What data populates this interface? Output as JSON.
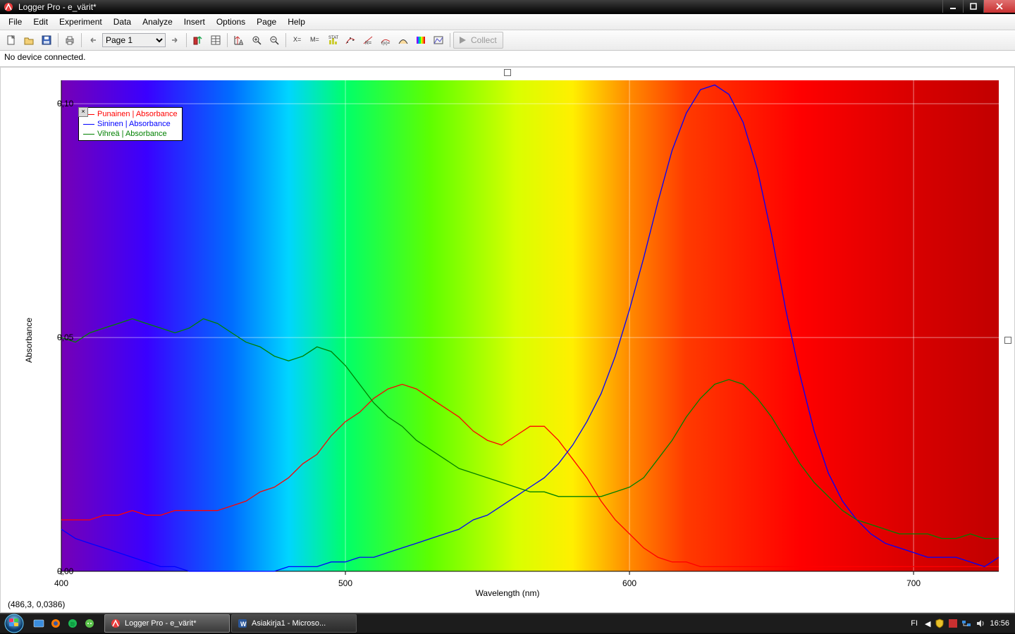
{
  "title": "Logger Pro - e_värit*",
  "menu": [
    "File",
    "Edit",
    "Experiment",
    "Data",
    "Analyze",
    "Insert",
    "Options",
    "Page",
    "Help"
  ],
  "page_selector": "Page 1",
  "collect_label": "Collect",
  "status_line": "No device connected.",
  "xlabel": "Wavelength (nm)",
  "ylabel": "Absorbance",
  "cursor_readout": "(486,3, 0,0386)",
  "yticks": [
    "0,00",
    "0,05",
    "0,10"
  ],
  "xticks": [
    "400",
    "500",
    "600",
    "700"
  ],
  "legend": {
    "items": [
      {
        "label": "Punainen | Absorbance",
        "color": "#ff0000"
      },
      {
        "label": "Sininen | Absorbance",
        "color": "#0000ff"
      },
      {
        "label": "Vihreä | Absorbance",
        "color": "#008000"
      }
    ]
  },
  "taskbar": {
    "tasks": [
      {
        "label": "Logger Pro - e_värit*",
        "icon": "logger"
      },
      {
        "label": "Asiakirja1 - Microso...",
        "icon": "word"
      }
    ],
    "lang": "FI",
    "clock": "16:56"
  },
  "chart_data": {
    "type": "line",
    "xlabel": "Wavelength (nm)",
    "ylabel": "Absorbance",
    "xlim": [
      400,
      730
    ],
    "ylim": [
      0,
      0.105
    ],
    "xticks": [
      400,
      500,
      600,
      700
    ],
    "yticks": [
      0,
      0.05,
      0.1
    ],
    "x": [
      400,
      405,
      410,
      415,
      420,
      425,
      430,
      435,
      440,
      445,
      450,
      455,
      460,
      465,
      470,
      475,
      480,
      485,
      490,
      495,
      500,
      505,
      510,
      515,
      520,
      525,
      530,
      535,
      540,
      545,
      550,
      555,
      560,
      565,
      570,
      575,
      580,
      585,
      590,
      595,
      600,
      605,
      610,
      615,
      620,
      625,
      630,
      635,
      640,
      645,
      650,
      655,
      660,
      665,
      670,
      675,
      680,
      685,
      690,
      695,
      700,
      705,
      710,
      715,
      720,
      725,
      730
    ],
    "series": [
      {
        "name": "Punainen | Absorbance",
        "color": "#ff0000",
        "values": [
          0.011,
          0.011,
          0.011,
          0.012,
          0.012,
          0.013,
          0.012,
          0.012,
          0.013,
          0.013,
          0.013,
          0.013,
          0.014,
          0.015,
          0.017,
          0.018,
          0.02,
          0.023,
          0.025,
          0.029,
          0.032,
          0.034,
          0.037,
          0.039,
          0.04,
          0.039,
          0.037,
          0.035,
          0.033,
          0.03,
          0.028,
          0.027,
          0.029,
          0.031,
          0.031,
          0.028,
          0.024,
          0.02,
          0.015,
          0.011,
          0.008,
          0.005,
          0.003,
          0.002,
          0.002,
          0.001,
          0.001,
          0.001,
          0.001,
          0.001,
          0.001,
          0.001,
          0.001,
          0.001,
          0.001,
          0.001,
          0.001,
          0.001,
          0.001,
          0.001,
          0.001,
          0.001,
          0.001,
          0.001,
          0.001,
          0.001,
          0.001
        ]
      },
      {
        "name": "Sininen | Absorbance",
        "color": "#0000ff",
        "values": [
          0.009,
          0.007,
          0.006,
          0.005,
          0.004,
          0.003,
          0.002,
          0.001,
          0.001,
          0.0,
          0.0,
          0.0,
          0.0,
          0.0,
          0.0,
          0.0,
          0.001,
          0.001,
          0.001,
          0.002,
          0.002,
          0.003,
          0.003,
          0.004,
          0.005,
          0.006,
          0.007,
          0.008,
          0.009,
          0.011,
          0.012,
          0.014,
          0.016,
          0.018,
          0.02,
          0.023,
          0.027,
          0.032,
          0.038,
          0.046,
          0.056,
          0.067,
          0.079,
          0.09,
          0.098,
          0.103,
          0.104,
          0.102,
          0.096,
          0.086,
          0.072,
          0.056,
          0.042,
          0.03,
          0.021,
          0.015,
          0.011,
          0.008,
          0.006,
          0.005,
          0.004,
          0.003,
          0.003,
          0.003,
          0.002,
          0.001,
          0.003
        ]
      },
      {
        "name": "Vihreä | Absorbance",
        "color": "#008000",
        "values": [
          0.05,
          0.049,
          0.051,
          0.052,
          0.053,
          0.054,
          0.053,
          0.052,
          0.051,
          0.052,
          0.054,
          0.053,
          0.051,
          0.049,
          0.048,
          0.046,
          0.045,
          0.046,
          0.048,
          0.047,
          0.044,
          0.04,
          0.036,
          0.033,
          0.031,
          0.028,
          0.026,
          0.024,
          0.022,
          0.021,
          0.02,
          0.019,
          0.018,
          0.017,
          0.017,
          0.016,
          0.016,
          0.016,
          0.016,
          0.017,
          0.018,
          0.02,
          0.024,
          0.028,
          0.033,
          0.037,
          0.04,
          0.041,
          0.04,
          0.037,
          0.033,
          0.028,
          0.023,
          0.019,
          0.016,
          0.013,
          0.011,
          0.01,
          0.009,
          0.008,
          0.008,
          0.008,
          0.007,
          0.007,
          0.008,
          0.007,
          0.007
        ]
      }
    ]
  }
}
